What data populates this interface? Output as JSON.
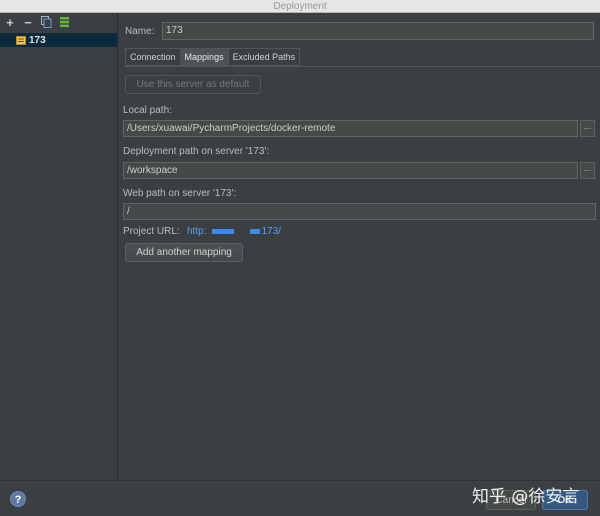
{
  "window": {
    "title": "Deployment"
  },
  "toolbar": {
    "add_symbol": "+",
    "remove_symbol": "−"
  },
  "sidebar": {
    "server_name": "173"
  },
  "name_field": {
    "label": "Name:",
    "value": "173"
  },
  "tabs": [
    {
      "label": "Connection"
    },
    {
      "label": "Mappings",
      "active": true
    },
    {
      "label": "Excluded Paths"
    }
  ],
  "default_button": {
    "label": "Use this server as default"
  },
  "local_path": {
    "label": "Local path:",
    "value": "/Users/xuawai/PycharmProjects/docker-remote",
    "browse": "..."
  },
  "deployment_path": {
    "label": "Deployment path on server '173':",
    "value": "/workspace",
    "browse": "..."
  },
  "web_path": {
    "label": "Web path on server '173':",
    "value": "/"
  },
  "project_url": {
    "label": "Project URL:",
    "prefix": "http:",
    "suffix": "173/"
  },
  "add_mapping_button": {
    "label": "Add another mapping"
  },
  "footer": {
    "help": "?",
    "cancel": "Cancel",
    "ok": "OK",
    "watermark": "知乎 @徐安言"
  },
  "colors": {
    "background": "#3c3f41",
    "selection": "#0d293e",
    "link": "#589df6",
    "ok_button": "#365880"
  }
}
